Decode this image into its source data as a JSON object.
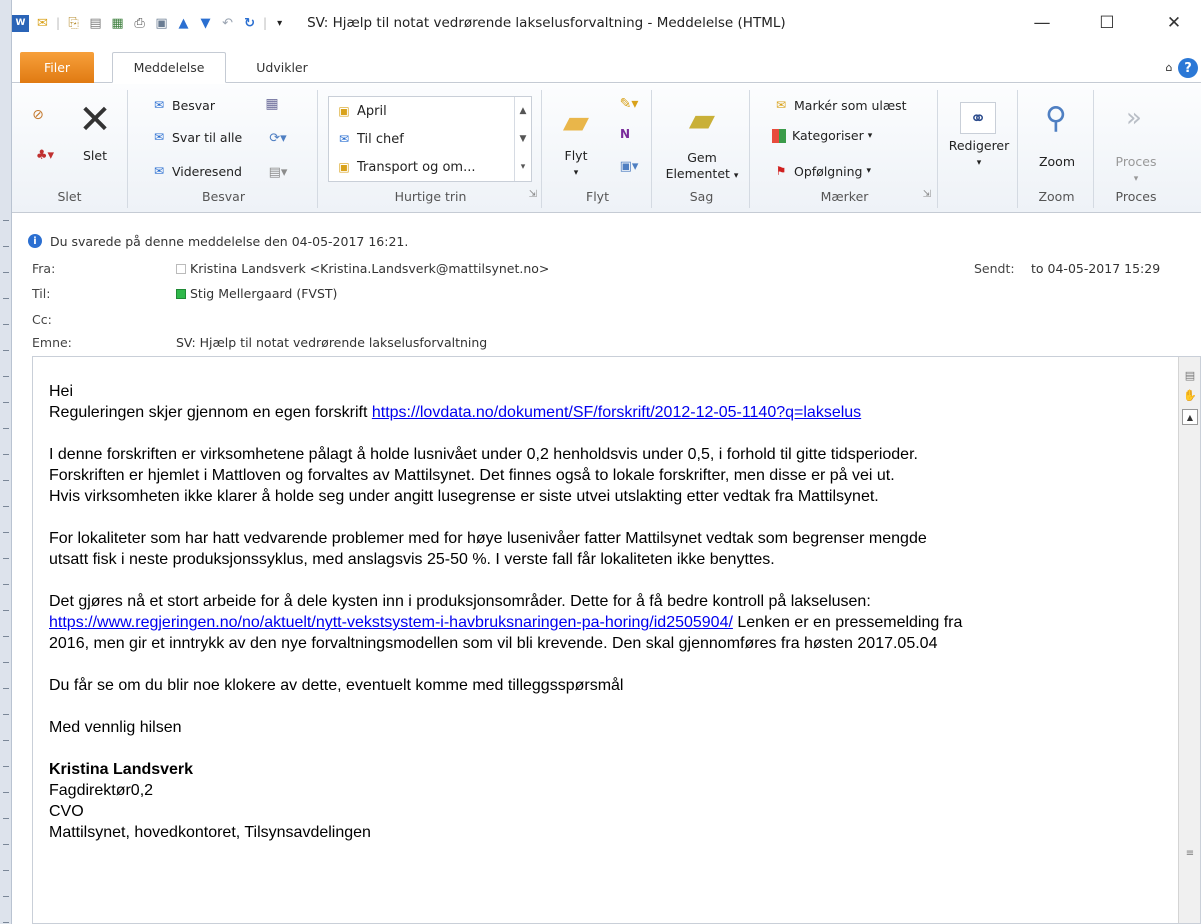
{
  "window": {
    "title": "SV: Hjælp til notat vedrørende lakselusforvaltning  -  Meddelelse (HTML)",
    "minimize": "—",
    "maximize": "☐",
    "close": "✕"
  },
  "tabs": {
    "file": "Filer",
    "message": "Meddelelse",
    "developer": "Udvikler",
    "help": "?"
  },
  "ribbon": {
    "delete_group": {
      "label": "Slet",
      "delete": "Slet"
    },
    "respond_group": {
      "label": "Besvar",
      "reply": "Besvar",
      "reply_all": "Svar til alle",
      "forward": "Videresend"
    },
    "quicksteps_group": {
      "label": "Hurtige trin",
      "items": [
        "April",
        "Til chef",
        "Transport og om..."
      ]
    },
    "move_group": {
      "label": "Flyt",
      "move": "Flyt"
    },
    "save_group": {
      "label": "Sag",
      "save_line1": "Gem",
      "save_line2": "Elementet"
    },
    "tags_group": {
      "label": "Mærker",
      "mark_unread": "Markér som ulæst",
      "categorize": "Kategoriser",
      "followup": "Opfølgning"
    },
    "edit_group": {
      "edit": "Redigerer"
    },
    "zoom_group": {
      "label": "Zoom",
      "zoom": "Zoom"
    },
    "process_group": {
      "label": "Proces",
      "process": "Proces"
    }
  },
  "header": {
    "info": "Du svarede på denne meddelelse den 04-05-2017 16:21.",
    "from_label": "Fra:",
    "from_value": "Kristina Landsverk <Kristina.Landsverk@mattilsynet.no>",
    "sent_label": "Sendt:",
    "sent_value": "to 04-05-2017 15:29",
    "to_label": "Til:",
    "to_value": "Stig Mellergaard (FVST)",
    "cc_label": "Cc:",
    "subject_label": "Emne:",
    "subject_value": "SV: Hjælp til notat vedrørende lakselusforvaltning"
  },
  "body": {
    "greeting": "Hei",
    "p1_text": "Reguleringen skjer gjennom en egen forskrift ",
    "p1_link": "https://lovdata.no/dokument/SF/forskrift/2012-12-05-1140?q=lakselus",
    "p2_l1": "I denne forskriften er virksomhetene pålagt å holde lusnivået under 0,2 henholdsvis under 0,5, i forhold til gitte tidsperioder.",
    "p2_l2": "Forskriften er hjemlet i Mattloven og forvaltes av Mattilsynet. Det finnes også to lokale forskrifter, men disse er på vei ut.",
    "p2_l3": "Hvis virksomheten ikke klarer å holde seg under angitt lusegrense er siste utvei utslakting etter vedtak fra Mattilsynet.",
    "p3_l1": "For lokaliteter som har hatt vedvarende problemer med for høye lusenivåer fatter Mattilsynet vedtak som begrenser mengde",
    "p3_l2": "utsatt fisk i neste produksjonssyklus, med anslagsvis 25-50 %. I verste fall får lokaliteten ikke benyttes.",
    "p4_l1": "Det gjøres nå et stort arbeide for å dele kysten inn i produksjonsområder. Dette for å få bedre kontroll på lakselusen:",
    "p4_link": "https://www.regjeringen.no/no/aktuelt/nytt-vekstsystem-i-havbruksnaringen-pa-horing/id2505904/",
    "p4_l2_rest": " Lenken er en pressemelding fra",
    "p4_l3": "2016, men gir et inntrykk av den nye forvaltningsmodellen som vil bli krevende. Den skal gjennomføres fra høsten 2017.05.04",
    "p5": "Du får se om du blir noe klokere av dette, eventuelt komme med tilleggsspørsmål",
    "closing": "Med vennlig hilsen",
    "sig_name": "Kristina Landsverk",
    "sig_title": "Fagdirektør0,2",
    "sig_role": "CVO",
    "sig_org": "Mattilsynet, hovedkontoret, Tilsynsavdelingen"
  }
}
